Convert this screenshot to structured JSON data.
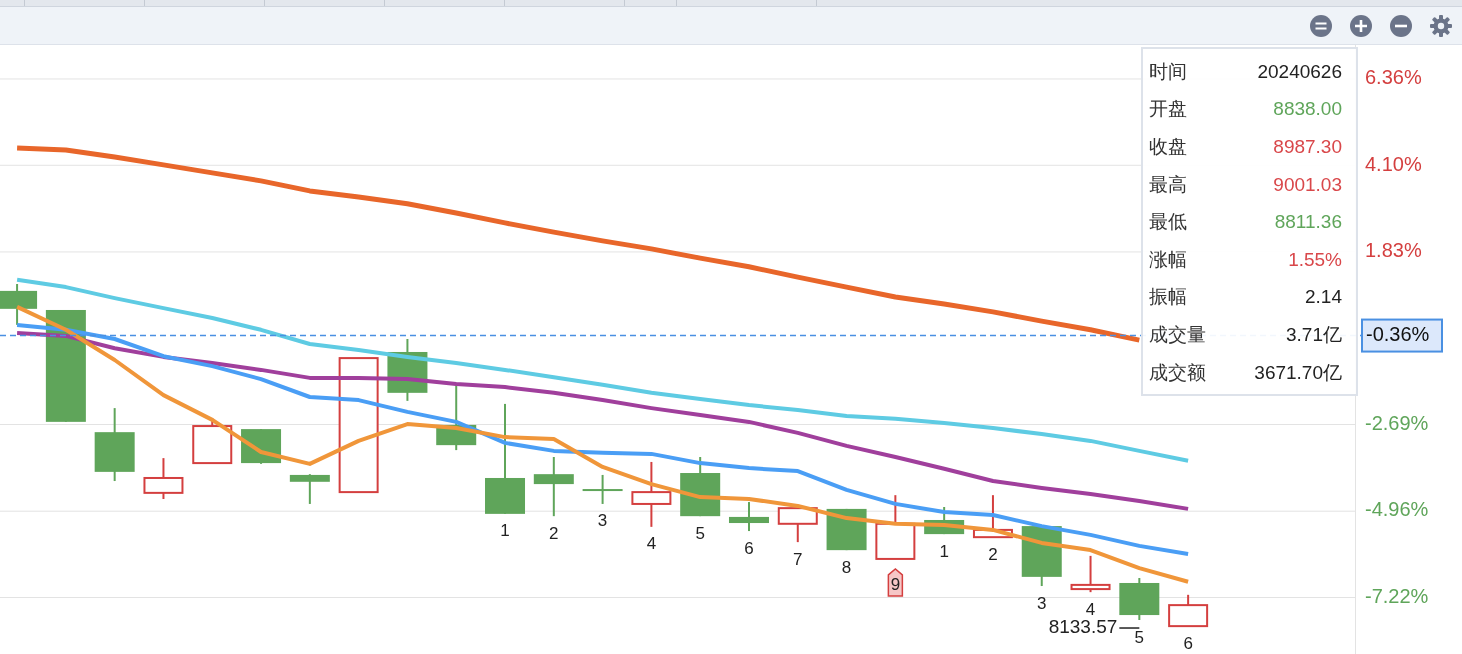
{
  "toolbar": {
    "buttons": [
      {
        "kind": "reset"
      },
      {
        "kind": "zoom_in"
      },
      {
        "kind": "zoom_out"
      },
      {
        "kind": "settings"
      }
    ]
  },
  "chart": {
    "axis_labels": [
      {
        "text": "6.36%",
        "color": "#d43f3f"
      },
      {
        "text": "4.10%",
        "color": "#d43f3f"
      },
      {
        "text": "1.83%",
        "color": "#d43f3f"
      },
      {
        "text": "-2.69%",
        "color": "#5fa55a"
      },
      {
        "text": "-4.96%",
        "color": "#5fa55a"
      },
      {
        "text": "-7.22%",
        "color": "#5fa55a"
      }
    ],
    "candle_labels": [
      {
        "kind": "count",
        "text": "1"
      },
      {
        "kind": "count",
        "text": "2"
      },
      {
        "kind": "count",
        "text": "3"
      },
      {
        "kind": "count",
        "text": "4"
      },
      {
        "kind": "count",
        "text": "5"
      },
      {
        "kind": "count",
        "text": "6"
      },
      {
        "kind": "count",
        "text": "7"
      },
      {
        "kind": "count",
        "text": "8"
      },
      {
        "kind": "badge",
        "text": "9"
      },
      {
        "kind": "count",
        "text": "1"
      },
      {
        "kind": "count",
        "text": "2"
      },
      {
        "kind": "count",
        "text": "3"
      },
      {
        "kind": "count",
        "text": "4"
      },
      {
        "kind": "count",
        "text": "5"
      },
      {
        "kind": "count",
        "text": "6"
      }
    ],
    "low_price": "8133.57",
    "current_value": "-0.36%",
    "tooltip": {
      "rows": [
        {
          "label": "时间",
          "value": "20240626",
          "color": "#222222"
        },
        {
          "label": "开盘",
          "value": "8838.00",
          "color": "#5fa55a"
        },
        {
          "label": "收盘",
          "value": "8987.30",
          "color": "#d9474a"
        },
        {
          "label": "最高",
          "value": "9001.03",
          "color": "#d9474a"
        },
        {
          "label": "最低",
          "value": "8811.36",
          "color": "#5fa55a"
        },
        {
          "label": "涨幅",
          "value": "1.55%",
          "color": "#d9474a"
        },
        {
          "label": "振幅",
          "value": "2.14",
          "color": "#222222"
        },
        {
          "label": "成交量",
          "value": "3.71亿",
          "color": "#222222"
        },
        {
          "label": "成交额",
          "value": "3671.70亿",
          "color": "#222222"
        }
      ]
    }
  }
}
